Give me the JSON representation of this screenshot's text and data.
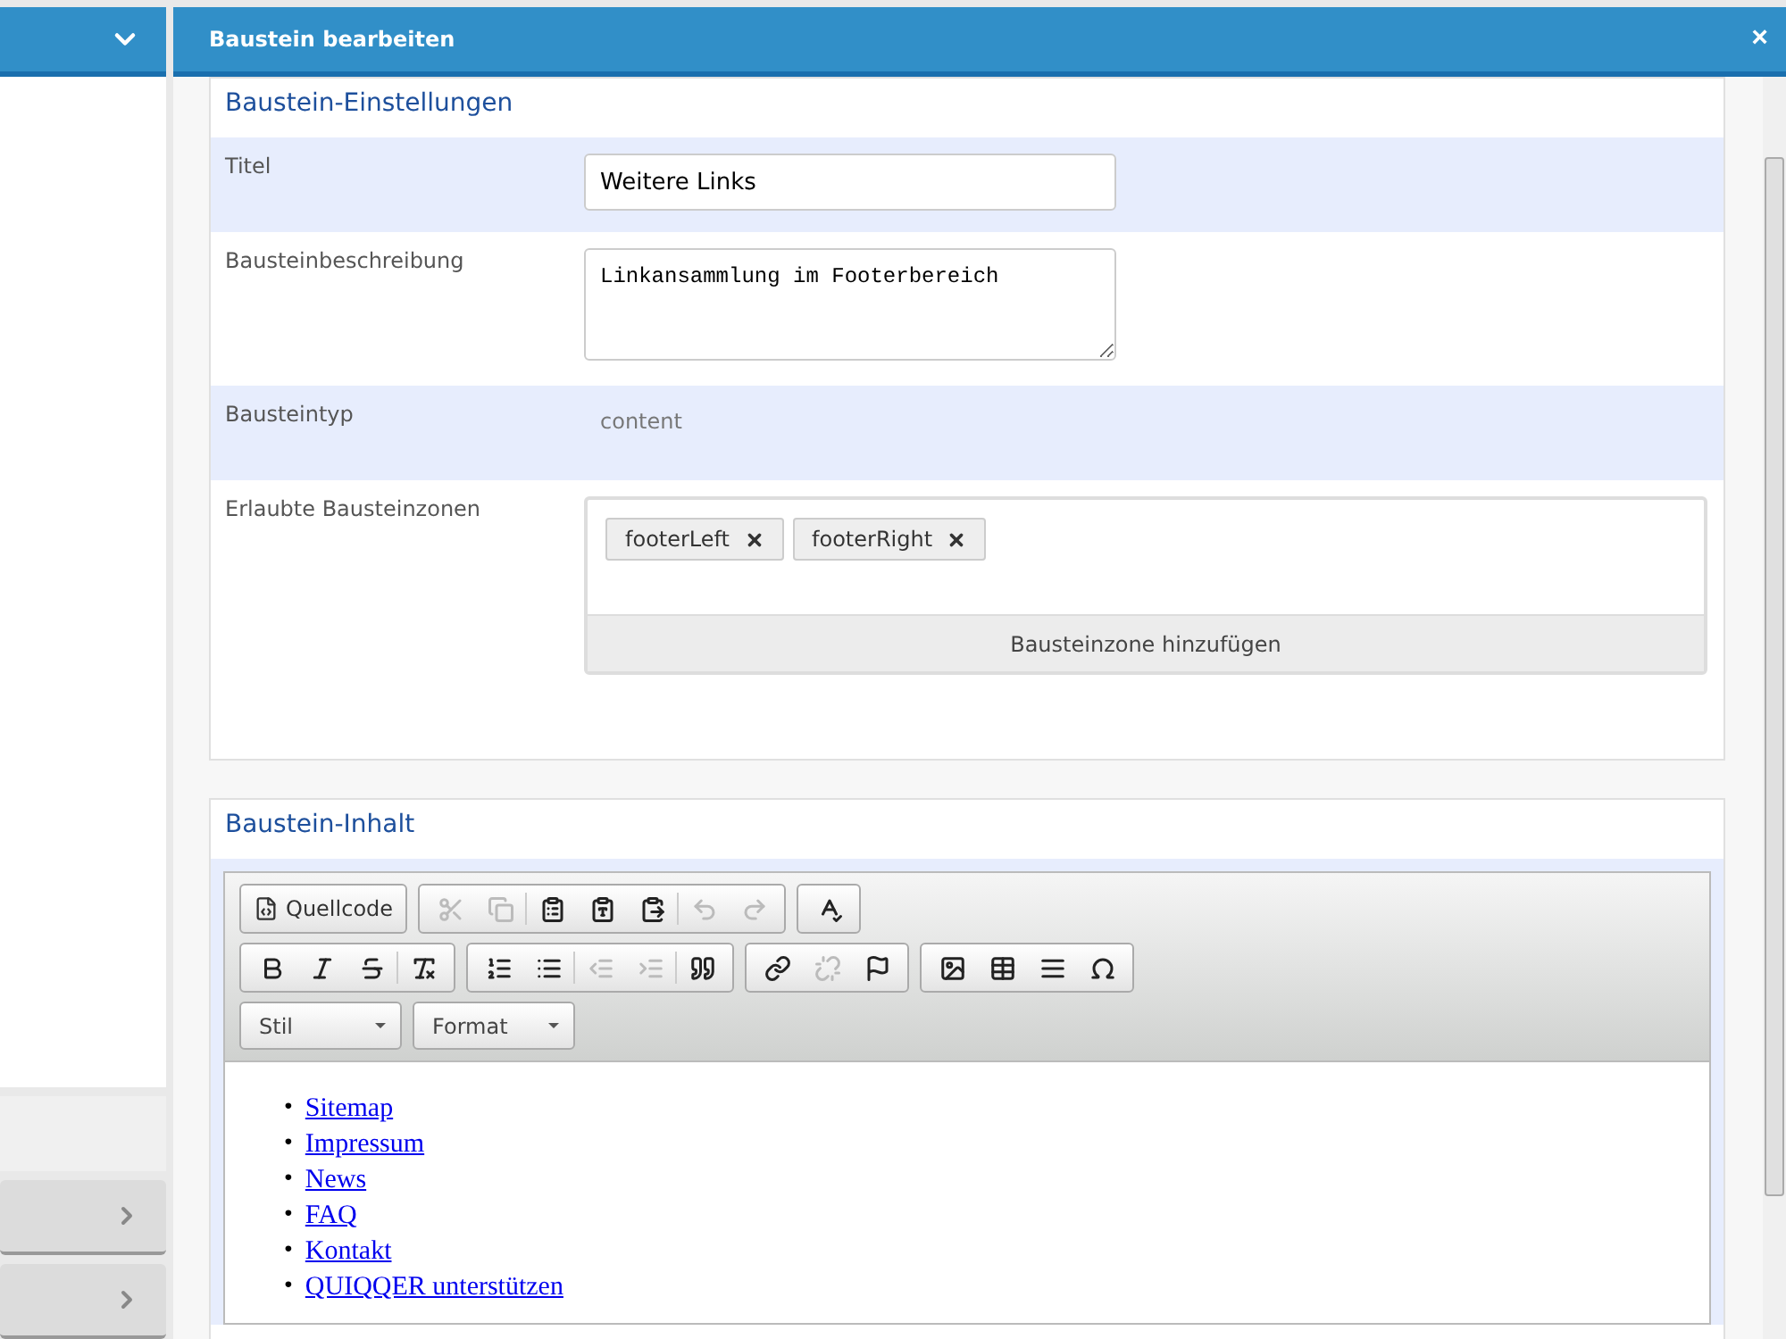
{
  "sidebar": {
    "accordion_items": [
      {
        "expanded": false
      },
      {
        "expanded": false
      }
    ]
  },
  "dialog": {
    "title": "Baustein bearbeiten",
    "close": "×"
  },
  "settings": {
    "heading": "Baustein-Einstellungen",
    "rows": [
      {
        "kind": "input",
        "label": "Titel",
        "value": "Weitere Links"
      },
      {
        "kind": "textarea",
        "label": "Bausteinbeschreibung",
        "value": "Linkansammlung im Footerbereich"
      },
      {
        "kind": "static",
        "label": "Bausteintyp",
        "value": "content"
      },
      {
        "kind": "tags",
        "label": "Erlaubte Bausteinzonen",
        "tags": [
          "footerLeft",
          "footerRight"
        ],
        "add_button": "Bausteinzone hinzufügen"
      }
    ]
  },
  "content": {
    "heading": "Baustein-Inhalt",
    "toolbar": {
      "source_button": "Quellcode",
      "groups": [
        [
          {
            "disabled": true
          },
          {
            "disabled": true
          },
          {
            "disabled": false
          },
          {
            "disabled": false
          },
          {
            "disabled": false
          },
          {
            "disabled": true
          },
          {
            "disabled": true
          }
        ],
        [
          {
            "disabled": false
          }
        ],
        [
          {
            "disabled": false
          },
          {
            "disabled": false
          },
          {
            "disabled": false
          },
          {
            "disabled": false
          }
        ],
        [
          {
            "disabled": false
          },
          {
            "disabled": false
          },
          {
            "disabled": true
          },
          {
            "disabled": true
          },
          {
            "disabled": false
          }
        ],
        [
          {
            "disabled": false
          },
          {
            "disabled": true
          },
          {
            "disabled": false
          }
        ],
        [
          {
            "disabled": false
          },
          {
            "disabled": false
          },
          {
            "disabled": false
          },
          {
            "disabled": false
          }
        ]
      ],
      "dropdowns": [
        "Stil",
        "Format"
      ]
    },
    "links": [
      {
        "bullet": "•",
        "text": "Sitemap"
      },
      {
        "bullet": "•",
        "text": "Impressum"
      },
      {
        "bullet": "•",
        "text": "News"
      },
      {
        "bullet": "•",
        "text": "FAQ"
      },
      {
        "bullet": "•",
        "text": "Kontakt"
      },
      {
        "bullet": "•",
        "text": "QUIQQER unterstützen"
      }
    ]
  }
}
